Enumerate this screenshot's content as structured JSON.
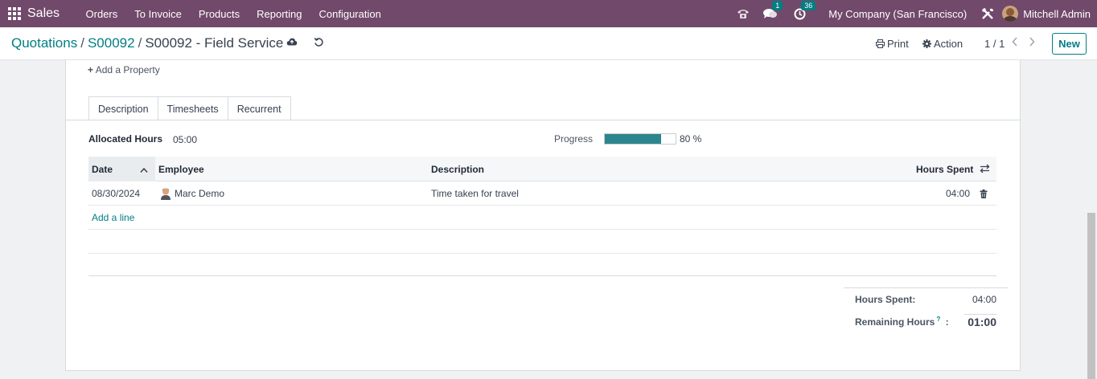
{
  "navbar": {
    "brand": "Sales",
    "menu": [
      "Orders",
      "To Invoice",
      "Products",
      "Reporting",
      "Configuration"
    ],
    "chat_badge": "1",
    "activity_badge": "36",
    "company": "My Company (San Francisco)",
    "user": "Mitchell Admin",
    "icons": [
      "apps-grid-icon",
      "phone-icon",
      "chat-icon",
      "clock-icon",
      "tools-icon",
      "avatar"
    ]
  },
  "control": {
    "breadcrumb": [
      "Quotations",
      "S00092"
    ],
    "current": "S00092 - Field Service",
    "print_label": "Print",
    "action_label": "Action",
    "pager": "1 / 1",
    "new_label": "New"
  },
  "sheet": {
    "add_property": "Add a Property",
    "tabs": [
      "Description",
      "Timesheets",
      "Recurrent"
    ],
    "active_tab": "Timesheets",
    "allocated_label": "Allocated Hours",
    "allocated_value": "05:00",
    "progress_label": "Progress",
    "progress_percent": 80,
    "progress_text": "80 %"
  },
  "table": {
    "headers": {
      "date": "Date",
      "employee": "Employee",
      "description": "Description",
      "hours": "Hours Spent"
    },
    "rows": [
      {
        "date": "08/30/2024",
        "employee": "Marc Demo",
        "description": "Time taken for travel",
        "hours": "04:00"
      }
    ],
    "add_line": "Add a line"
  },
  "totals": {
    "spent_label": "Hours Spent:",
    "spent_value": "04:00",
    "remaining_label": "Remaining Hours",
    "remaining_help": "?",
    "remaining_colon": ":",
    "remaining_value": "01:00"
  },
  "colors": {
    "navbar": "#71496a",
    "accent": "#017e84",
    "progress": "#2b868d"
  }
}
